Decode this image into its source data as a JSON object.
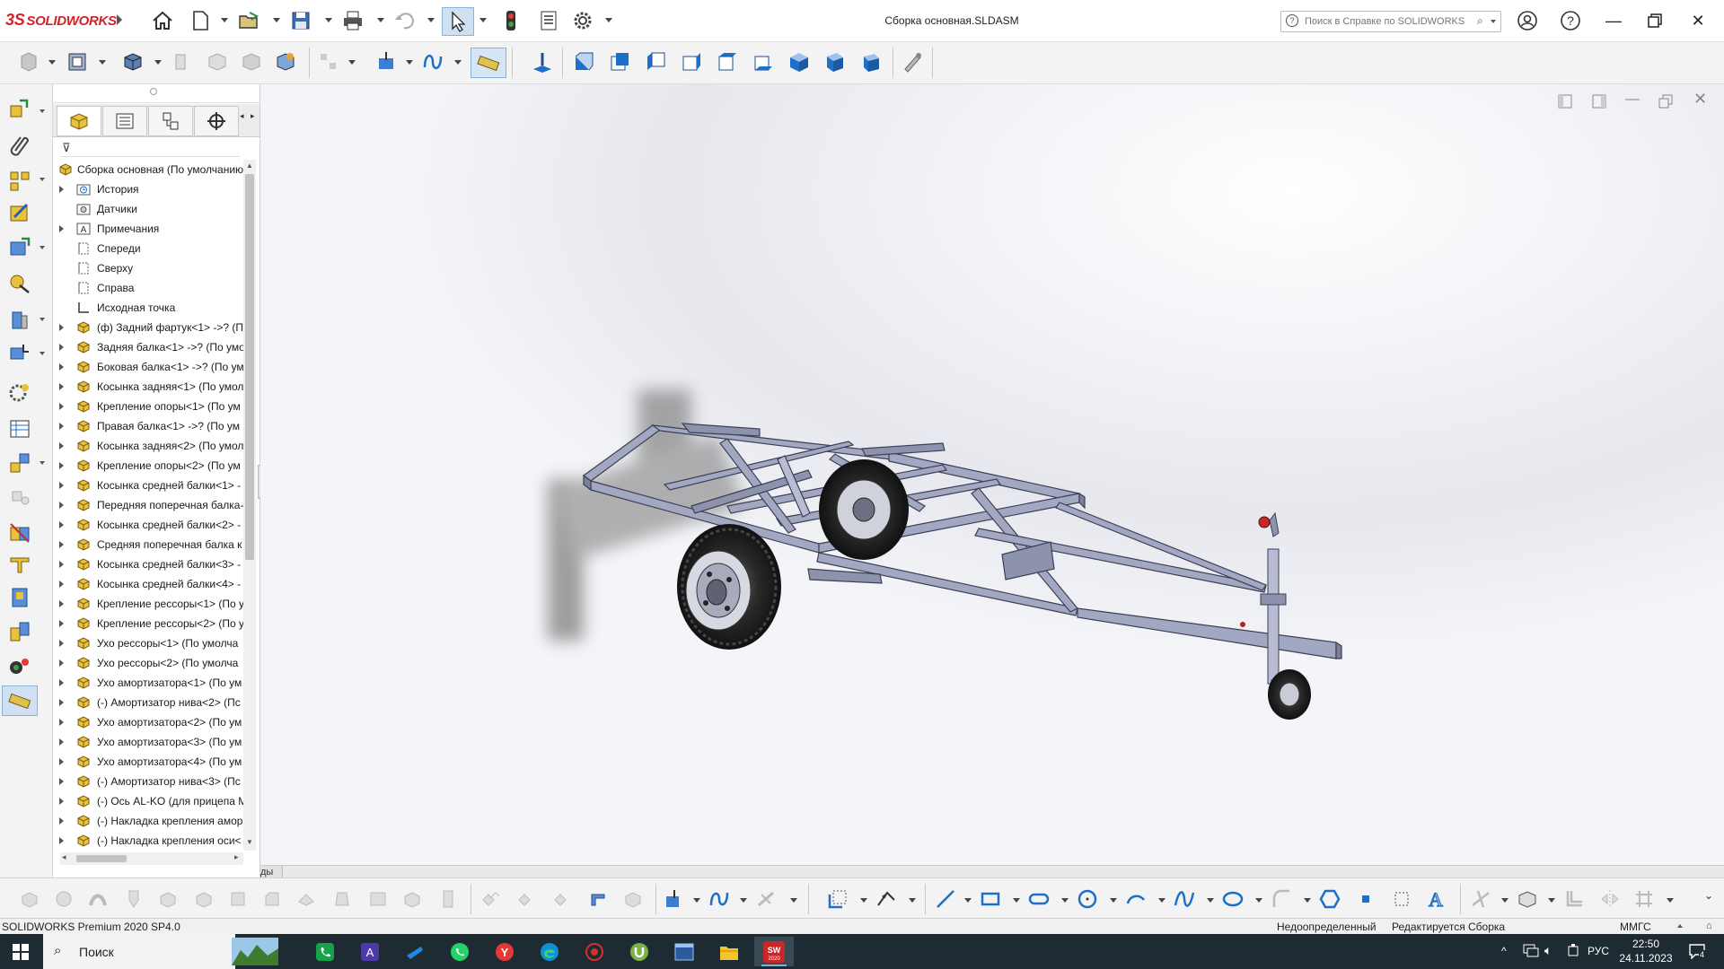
{
  "app": {
    "brand": "SOLIDWORKS",
    "document_title": "Сборка основная.SLDASM"
  },
  "help_search": {
    "placeholder": "Поиск в Справке по SOLIDWORKS"
  },
  "feature_tree": {
    "root": "Сборка основная  (По умолчанию",
    "items": [
      {
        "label": "История",
        "icon": "history-folder-icon",
        "expandable": true
      },
      {
        "label": "Датчики",
        "icon": "sensors-icon",
        "expandable": false
      },
      {
        "label": "Примечания",
        "icon": "annotations-icon",
        "expandable": true
      },
      {
        "label": "Спереди",
        "icon": "plane-icon",
        "expandable": false
      },
      {
        "label": "Сверху",
        "icon": "plane-icon",
        "expandable": false
      },
      {
        "label": "Справа",
        "icon": "plane-icon",
        "expandable": false
      },
      {
        "label": "Исходная точка",
        "icon": "origin-icon",
        "expandable": false
      },
      {
        "label": "(ф) Задний фартук<1> ->? (П",
        "icon": "part-icon",
        "expandable": true
      },
      {
        "label": "Задняя балка<1> ->? (По умо",
        "icon": "part-icon",
        "expandable": true
      },
      {
        "label": "Боковая балка<1> ->? (По ум",
        "icon": "part-icon",
        "expandable": true
      },
      {
        "label": "Косынка задняя<1> (По умол",
        "icon": "part-icon",
        "expandable": true
      },
      {
        "label": "Крепление опоры<1> (По ум",
        "icon": "part-icon",
        "expandable": true
      },
      {
        "label": "Правая балка<1> ->? (По ум",
        "icon": "part-icon",
        "expandable": true
      },
      {
        "label": "Косынка задняя<2> (По умол",
        "icon": "part-icon",
        "expandable": true
      },
      {
        "label": "Крепление опоры<2> (По ум",
        "icon": "part-icon",
        "expandable": true
      },
      {
        "label": "Косынка средней балки<1> -",
        "icon": "part-icon",
        "expandable": true
      },
      {
        "label": "Передняя поперечная балка-",
        "icon": "part-icon",
        "expandable": true
      },
      {
        "label": "Косынка средней балки<2> -",
        "icon": "part-icon",
        "expandable": true
      },
      {
        "label": "Средняя поперечная балка к",
        "icon": "part-icon",
        "expandable": true
      },
      {
        "label": "Косынка средней балки<3> -",
        "icon": "part-icon",
        "expandable": true
      },
      {
        "label": "Косынка средней балки<4> -",
        "icon": "part-icon",
        "expandable": true
      },
      {
        "label": "Крепление рессоры<1> (По у",
        "icon": "part-icon",
        "expandable": true
      },
      {
        "label": "Крепление рессоры<2> (По у",
        "icon": "part-icon",
        "expandable": true
      },
      {
        "label": "Ухо рессоры<1> (По умолча",
        "icon": "part-icon",
        "expandable": true
      },
      {
        "label": "Ухо рессоры<2> (По умолча",
        "icon": "part-icon",
        "expandable": true
      },
      {
        "label": "Ухо амортизатора<1> (По ум",
        "icon": "part-icon",
        "expandable": true
      },
      {
        "label": "(-) Амортизатор нива<2> (Пс",
        "icon": "part-icon",
        "expandable": true
      },
      {
        "label": "Ухо амортизатора<2> (По ум",
        "icon": "part-icon",
        "expandable": true
      },
      {
        "label": "Ухо амортизатора<3> (По ум",
        "icon": "part-icon",
        "expandable": true
      },
      {
        "label": "Ухо амортизатора<4> (По ум",
        "icon": "part-icon",
        "expandable": true
      },
      {
        "label": "(-) Амортизатор нива<3> (Пс",
        "icon": "part-icon",
        "expandable": true
      },
      {
        "label": "(-) Ось AL-KO (для прицепа М",
        "icon": "part-icon",
        "expandable": true
      },
      {
        "label": "(-) Накладка крепления амор",
        "icon": "part-icon",
        "expandable": true
      },
      {
        "label": "(-) Накладка крепления оси<",
        "icon": "part-icon",
        "expandable": true
      }
    ]
  },
  "bottom_tab": {
    "label": "ды"
  },
  "status": {
    "version": "SOLIDWORKS Premium 2020 SP4.0",
    "definition": "Недоопределенный",
    "mode": "Редактируется Сборка",
    "units": "ММГС"
  },
  "taskbar": {
    "search_placeholder": "Поиск",
    "language": "РУС",
    "time": "22:50",
    "date": "24.11.2023",
    "notification_count": "4"
  },
  "colors": {
    "brand_red": "#d2232a",
    "accent_blue": "#1e6fc7",
    "frame_steel": "#a3a8c2",
    "taskbar": "#1f2b33"
  }
}
